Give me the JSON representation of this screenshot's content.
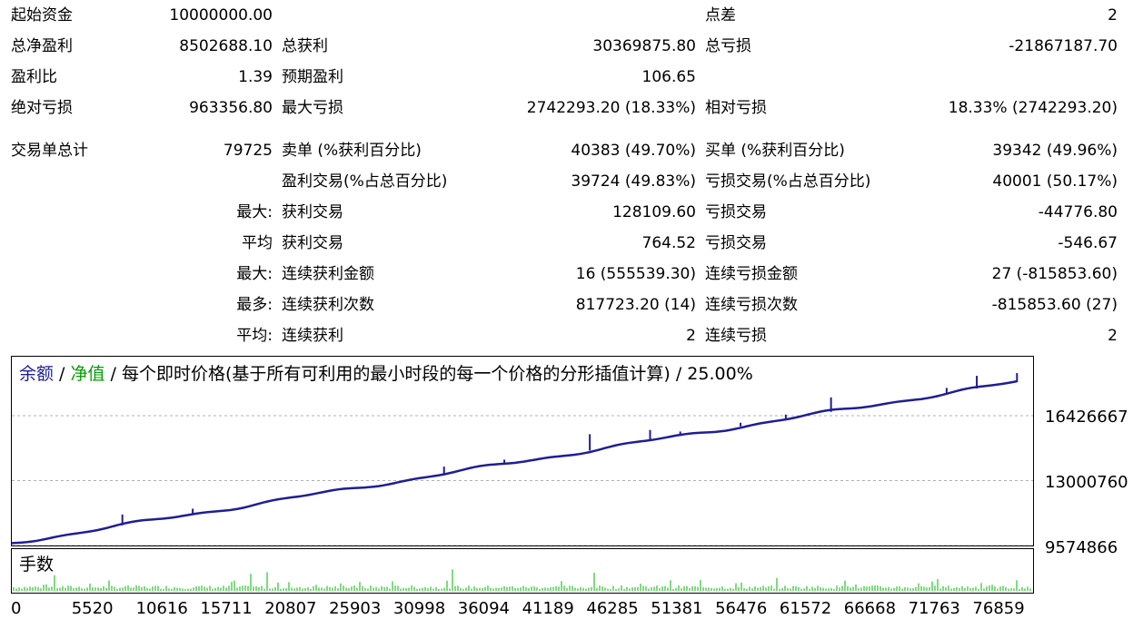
{
  "summary": {
    "initial_deposit_label": "起始资金",
    "initial_deposit_value": "10000000.00",
    "spread_label": "点差",
    "spread_value": "2",
    "net_profit_label": "总净盈利",
    "net_profit_value": "8502688.10",
    "gross_profit_label": "总获利",
    "gross_profit_value": "30369875.80",
    "gross_loss_label": "总亏损",
    "gross_loss_value": "-21867187.70",
    "profit_factor_label": "盈利比",
    "profit_factor_value": "1.39",
    "expected_payoff_label": "预期盈利",
    "expected_payoff_value": "106.65",
    "abs_drawdown_label": "绝对亏损",
    "abs_drawdown_value": "963356.80",
    "max_drawdown_label": "最大亏损",
    "max_drawdown_value": "2742293.20 (18.33%)",
    "rel_drawdown_label": "相对亏损",
    "rel_drawdown_value": "18.33% (2742293.20)",
    "total_trades_label": "交易单总计",
    "total_trades_value": "79725",
    "short_label": "卖单 (%获利百分比)",
    "short_value": "40383 (49.70%)",
    "long_label": "买单 (%获利百分比)",
    "long_value": "39342 (49.96%)",
    "profit_trades_label": "盈利交易(%占总百分比)",
    "profit_trades_value": "39724 (49.83%)",
    "loss_trades_label": "亏损交易(%占总百分比)",
    "loss_trades_value": "40001 (50.17%)",
    "largest_label": "最大:",
    "largest_profit_label": "获利交易",
    "largest_profit_value": "128109.60",
    "largest_loss_label": "亏损交易",
    "largest_loss_value": "-44776.80",
    "average_label": "平均",
    "average_profit_label": "获利交易",
    "average_profit_value": "764.52",
    "average_loss_label": "亏损交易",
    "average_loss_value": "-546.67",
    "max_consec_label": "最大:",
    "max_consec_wins_label": "连续获利金额",
    "max_consec_wins_value": "16 (555539.30)",
    "max_consec_losses_label": "连续亏损金额",
    "max_consec_losses_value": "27 (-815853.60)",
    "maximal_label": "最多:",
    "maximal_profit_label": "连续获利次数",
    "maximal_profit_value": "817723.20 (14)",
    "maximal_loss_label": "连续亏损次数",
    "maximal_loss_value": "-815853.60 (27)",
    "avg_consec_label": "平均:",
    "avg_consec_wins_label": "连续获利",
    "avg_consec_wins_value": "2",
    "avg_consec_losses_label": "连续亏损",
    "avg_consec_losses_value": "2"
  },
  "chart": {
    "legend_balance": "余额",
    "legend_sep1": " / ",
    "legend_equity": "净值",
    "legend_rest": " / 每个即时价格(基于所有可利用的最小时段的每一个价格的分形插值计算) / 25.00%",
    "volume_title": "手数",
    "colors": {
      "balance": "#1e1e96",
      "equity": "#00a000",
      "volume": "#00b400",
      "legend_balance": "#1e1e96"
    }
  },
  "chart_data": {
    "type": "line",
    "series": [
      {
        "name": "余额",
        "x": [
          0,
          79725
        ],
        "y": [
          9700000,
          18200000
        ]
      }
    ],
    "y_ticks": [
      "16426667",
      "13000760",
      "9574866"
    ],
    "y_tick_values": [
      16426667,
      13000760,
      9574866
    ],
    "x_ticks": [
      "0",
      "5520",
      "10616",
      "15711",
      "20807",
      "25903",
      "30998",
      "36094",
      "41189",
      "46285",
      "51381",
      "56476",
      "61572",
      "66668",
      "71763",
      "76859"
    ],
    "xlim": [
      0,
      81000
    ],
    "grid": true
  }
}
